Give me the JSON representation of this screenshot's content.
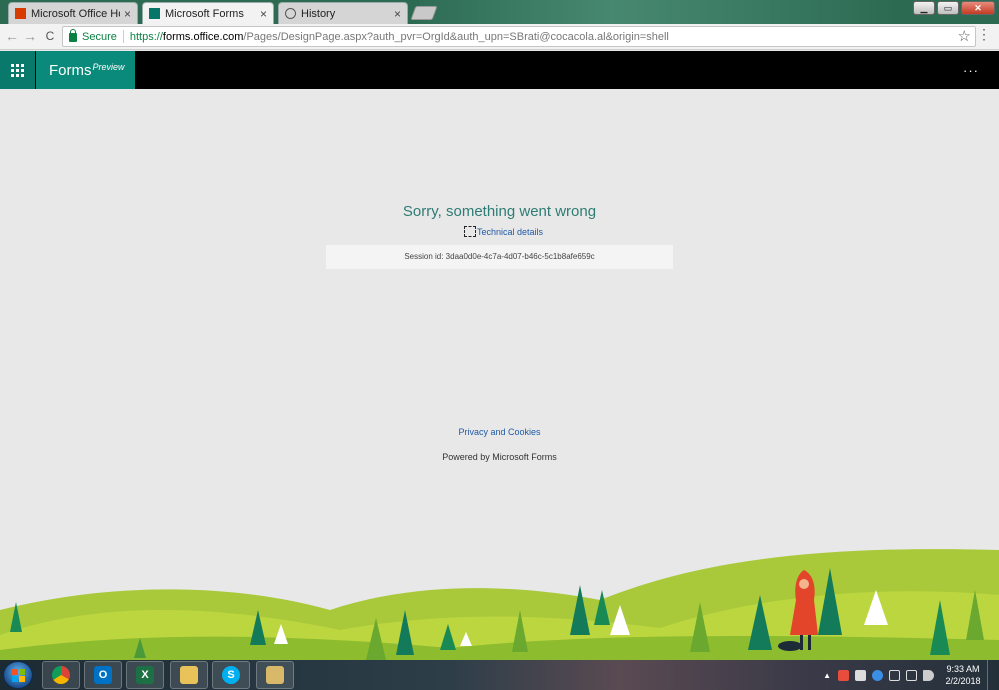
{
  "browser": {
    "tabs": [
      {
        "label": "Microsoft Office Home",
        "close": "×",
        "icon": "office-icon",
        "color": "#d83b01"
      },
      {
        "label": "Microsoft Forms",
        "close": "×",
        "icon": "forms-icon",
        "color": "#077568",
        "active": true
      },
      {
        "label": "History",
        "close": "×",
        "icon": "history-icon",
        "color": "#555555"
      }
    ],
    "window_controls": {
      "minimize": "▁",
      "maximize": "▭",
      "close": "✕"
    },
    "nav": {
      "back": "←",
      "forward": "→",
      "reload": "C"
    },
    "address": {
      "secure_label": "Secure",
      "url_scheme": "https://",
      "url_host": "forms.office.com",
      "url_path": "/Pages/DesignPage.aspx?auth_pvr=OrgId&auth_upn=SBrati@cocacola.al&origin=shell"
    },
    "bookmark": "☆",
    "menu": "⋮"
  },
  "app": {
    "brand_name": "Forms",
    "brand_tag": "Preview",
    "more": "···",
    "accent": "#0a8a7a"
  },
  "error": {
    "title": "Sorry, something went wrong",
    "technical_details": "Technical details",
    "session": "Session id: 3daa0d0e-4c7a-4d07-b46c-5c1b8afe659c"
  },
  "footer": {
    "privacy": "Privacy and Cookies",
    "powered": "Powered by Microsoft Forms"
  },
  "taskbar": {
    "apps": [
      {
        "name": "chrome",
        "glyph": "",
        "color": "#db4437"
      },
      {
        "name": "outlook",
        "glyph": "O",
        "color": "#0072c6"
      },
      {
        "name": "excel",
        "glyph": "X",
        "color": "#1d7044"
      },
      {
        "name": "explorer",
        "glyph": "",
        "color": "#e8c35a"
      },
      {
        "name": "skype",
        "glyph": "S",
        "color": "#00aff0"
      },
      {
        "name": "files",
        "glyph": "",
        "color": "#d9b86a"
      }
    ],
    "show_hidden": "▲",
    "time": "9:33 AM",
    "date": "2/2/2018"
  }
}
